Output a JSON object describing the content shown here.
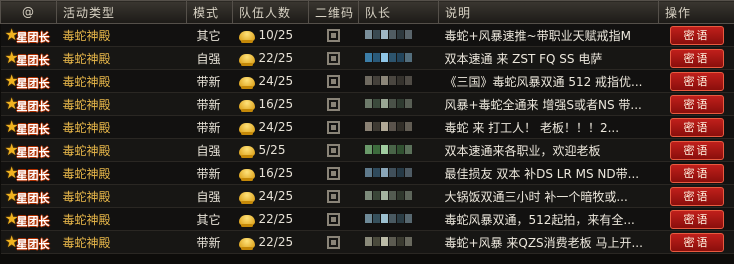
{
  "columns": {
    "badge": "@",
    "activity": "活动类型",
    "mode": "模式",
    "team": "队伍人数",
    "qr": "二维码",
    "leader": "队长",
    "desc": "说明",
    "op": "操作"
  },
  "badge_text": "星团长",
  "button_label": "密语",
  "rows": [
    {
      "activity": "毒蛇神殿",
      "mode": "其它",
      "team": "10/25",
      "desc": "毒蛇+风暴速推~带职业天赋戒指M"
    },
    {
      "activity": "毒蛇神殿",
      "mode": "自强",
      "team": "22/25",
      "desc": "双本速通 来 ZST FQ SS 电萨"
    },
    {
      "activity": "毒蛇神殿",
      "mode": "带新",
      "team": "24/25",
      "desc": "《三国》毒蛇风暴双通 512 戒指优..."
    },
    {
      "activity": "毒蛇神殿",
      "mode": "带新",
      "team": "16/25",
      "desc": "风暴+毒蛇全通来 增强S或者NS 带..."
    },
    {
      "activity": "毒蛇神殿",
      "mode": "带新",
      "team": "24/25",
      "desc": "毒蛇 来 打工人！ 老板！！！2..."
    },
    {
      "activity": "毒蛇神殿",
      "mode": "自强",
      "team": "5/25",
      "desc": "双本速通来各职业，欢迎老板"
    },
    {
      "activity": "毒蛇神殿",
      "mode": "带新",
      "team": "16/25",
      "desc": "最佳损友 双本 补DS LR MS ND带..."
    },
    {
      "activity": "毒蛇神殿",
      "mode": "自强",
      "team": "24/25",
      "desc": "大锅饭双通三小时 补一个暗牧或..."
    },
    {
      "activity": "毒蛇神殿",
      "mode": "其它",
      "team": "22/25",
      "desc": "毒蛇风暴双通，512起拍，来有全..."
    },
    {
      "activity": "毒蛇神殿",
      "mode": "带新",
      "team": "22/25",
      "desc": "毒蛇+风暴 来QZS消费老板 马上开..."
    }
  ],
  "colors": {
    "activity_text": "#e9b84a",
    "button_bg": "#a8150f",
    "header_bg": "#2a2723"
  },
  "icons": {
    "badge": "star-badge-icon",
    "team": "helmet-icon",
    "qr": "qr-code-icon"
  }
}
